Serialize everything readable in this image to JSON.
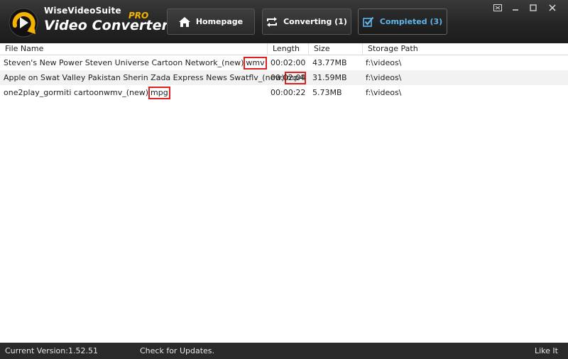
{
  "app": {
    "brand_line1": "WiseVideoSuite",
    "brand_line2": "Video Converter",
    "brand_pro": "PRO"
  },
  "nav": {
    "homepage": "Homepage",
    "converting": "Converting (1)",
    "completed": "Completed (3)"
  },
  "window_controls": [
    "▣",
    "–",
    "□",
    "✕"
  ],
  "table": {
    "columns": [
      "File Name",
      "Length",
      "Size",
      "Storage Path"
    ],
    "rows": [
      {
        "name": "Steven's New Power  Steven Universe  Cartoon Network_(new)",
        "ext": "wmv",
        "length": "00:02:00",
        "size": "43.77MB",
        "path": "f:\\videos\\"
      },
      {
        "name": "Apple on Swat Valley Pakistan Sherin Zada Express News Swatflv_(new)",
        "ext": "mp4",
        "length": "00:02:04",
        "size": "31.59MB",
        "path": "f:\\videos\\"
      },
      {
        "name": "one2play_gormiti cartoonwmv_(new)",
        "ext": "mpg",
        "length": "00:00:22",
        "size": "5.73MB",
        "path": "f:\\videos\\"
      }
    ]
  },
  "status": {
    "version": "Current Version:1.52.51",
    "updates": "Check for Updates.",
    "like": "Like It"
  },
  "colors": {
    "header_bg": "#232323",
    "active_tab_text": "#5fb4ec",
    "pro_gold": "#f5b300",
    "highlight_box": "#e02020",
    "status_bg": "#2a2a2a"
  }
}
